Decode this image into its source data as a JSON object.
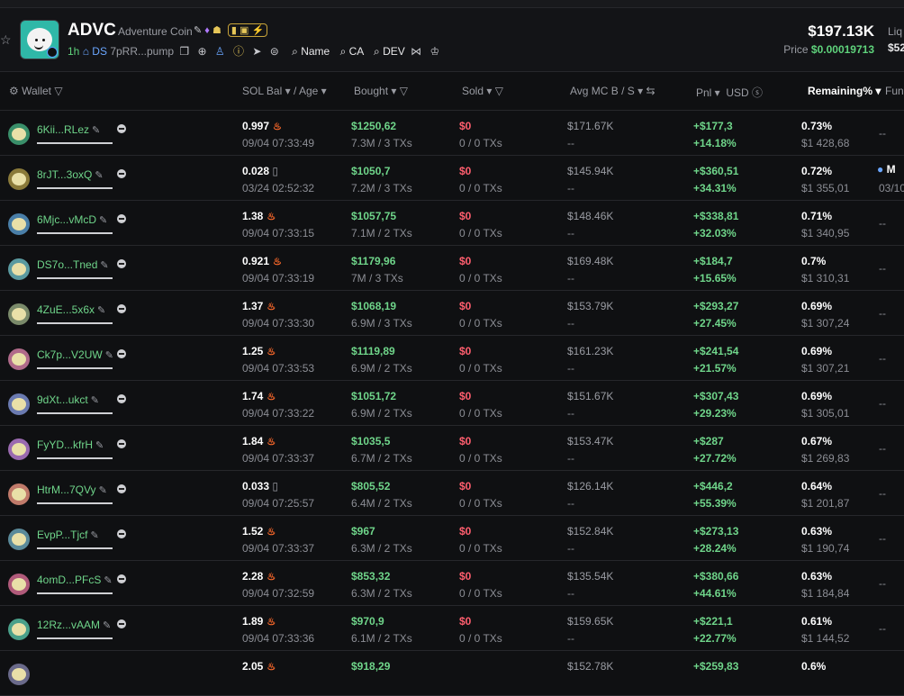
{
  "token": {
    "ticker": "ADVC",
    "name": "Adventure Coin",
    "age": "1h",
    "ds": "DS",
    "address": "7pRR...pump",
    "links": [
      "Name",
      "CA",
      "DEV"
    ],
    "market_cap": "$197.13K",
    "price_label": "Price",
    "price": "$0.00019713",
    "liq_label": "Liq",
    "liq_value": "$52"
  },
  "columns": {
    "wallet": "Wallet",
    "sol_bal": "SOL Bal",
    "age": "/ Age",
    "bought": "Bought",
    "sold": "Sold",
    "avg_mc": "Avg MC B",
    "avg_mc_s": "/ S",
    "pnl": "Pnl",
    "usd": "USD",
    "remaining": "Remaining%",
    "funding": "Fun"
  },
  "rows": [
    {
      "wallet": "6Kii...RLez",
      "sol": "0.997",
      "time": "09/04 07:33:49",
      "bought": "$1250,62",
      "bought_sub": "7.3M / 3 TXs",
      "sold": "$0",
      "sold_sub": "0 / 0 TXs",
      "avg": "$171.67K",
      "avg_sub": "--",
      "pnl": "+$177,3",
      "pnl_pct": "+14.18%",
      "rem": "0.73%",
      "rem_usd": "$1 428,68",
      "fund": "--",
      "fund_date": "",
      "color": "#3a8f6a"
    },
    {
      "wallet": "8rJT...3oxQ",
      "sol": "0.028",
      "time": "03/24 02:52:32",
      "bought": "$1050,7",
      "bought_sub": "7.2M / 3 TXs",
      "sold": "$0",
      "sold_sub": "0 / 0 TXs",
      "avg": "$145.94K",
      "avg_sub": "--",
      "pnl": "+$360,51",
      "pnl_pct": "+34.31%",
      "rem": "0.72%",
      "rem_usd": "$1 355,01",
      "fund": "M",
      "fund_date": "03/10",
      "color": "#8a7a3a"
    },
    {
      "wallet": "6Mjc...vMcD",
      "sol": "1.38",
      "time": "09/04 07:33:15",
      "bought": "$1057,75",
      "bought_sub": "7.1M / 2 TXs",
      "sold": "$0",
      "sold_sub": "0 / 0 TXs",
      "avg": "$148.46K",
      "avg_sub": "--",
      "pnl": "+$338,81",
      "pnl_pct": "+32.03%",
      "rem": "0.71%",
      "rem_usd": "$1 340,95",
      "fund": "--",
      "fund_date": "",
      "color": "#4a7fa8"
    },
    {
      "wallet": "DS7o...Tned",
      "sol": "0.921",
      "time": "09/04 07:33:19",
      "bought": "$1179,96",
      "bought_sub": "7M / 3 TXs",
      "sold": "$0",
      "sold_sub": "0 / 0 TXs",
      "avg": "$169.48K",
      "avg_sub": "--",
      "pnl": "+$184,7",
      "pnl_pct": "+15.65%",
      "rem": "0.7%",
      "rem_usd": "$1 310,31",
      "fund": "--",
      "fund_date": "",
      "color": "#5a9aa0"
    },
    {
      "wallet": "4ZuE...5x6x",
      "sol": "1.37",
      "time": "09/04 07:33:30",
      "bought": "$1068,19",
      "bought_sub": "6.9M / 3 TXs",
      "sold": "$0",
      "sold_sub": "0 / 0 TXs",
      "avg": "$153.79K",
      "avg_sub": "--",
      "pnl": "+$293,27",
      "pnl_pct": "+27.45%",
      "rem": "0.69%",
      "rem_usd": "$1 307,24",
      "fund": "--",
      "fund_date": "",
      "color": "#7a8a6a"
    },
    {
      "wallet": "Ck7p...V2UW",
      "sol": "1.25",
      "time": "09/04 07:33:53",
      "bought": "$1119,89",
      "bought_sub": "6.9M / 2 TXs",
      "sold": "$0",
      "sold_sub": "0 / 0 TXs",
      "avg": "$161.23K",
      "avg_sub": "--",
      "pnl": "+$241,54",
      "pnl_pct": "+21.57%",
      "rem": "0.69%",
      "rem_usd": "$1 307,21",
      "fund": "--",
      "fund_date": "",
      "color": "#b06a8a"
    },
    {
      "wallet": "9dXt...ukct",
      "sol": "1.74",
      "time": "09/04 07:33:22",
      "bought": "$1051,72",
      "bought_sub": "6.9M / 2 TXs",
      "sold": "$0",
      "sold_sub": "0 / 0 TXs",
      "avg": "$151.67K",
      "avg_sub": "--",
      "pnl": "+$307,43",
      "pnl_pct": "+29.23%",
      "rem": "0.69%",
      "rem_usd": "$1 305,01",
      "fund": "--",
      "fund_date": "",
      "color": "#6a7ab0"
    },
    {
      "wallet": "FyYD...kfrH",
      "sol": "1.84",
      "time": "09/04 07:33:37",
      "bought": "$1035,5",
      "bought_sub": "6.7M / 2 TXs",
      "sold": "$0",
      "sold_sub": "0 / 0 TXs",
      "avg": "$153.47K",
      "avg_sub": "--",
      "pnl": "+$287",
      "pnl_pct": "+27.72%",
      "rem": "0.67%",
      "rem_usd": "$1 269,83",
      "fund": "--",
      "fund_date": "",
      "color": "#9a6ab0"
    },
    {
      "wallet": "HtrM...7QVy",
      "sol": "0.033",
      "time": "09/04 07:25:57",
      "bought": "$805,52",
      "bought_sub": "6.4M / 2 TXs",
      "sold": "$0",
      "sold_sub": "0 / 0 TXs",
      "avg": "$126.14K",
      "avg_sub": "--",
      "pnl": "+$446,2",
      "pnl_pct": "+55.39%",
      "rem": "0.64%",
      "rem_usd": "$1 201,87",
      "fund": "--",
      "fund_date": "",
      "color": "#c07a6a"
    },
    {
      "wallet": "EvpP...Tjcf",
      "sol": "1.52",
      "time": "09/04 07:33:37",
      "bought": "$967",
      "bought_sub": "6.3M / 2 TXs",
      "sold": "$0",
      "sold_sub": "0 / 0 TXs",
      "avg": "$152.84K",
      "avg_sub": "--",
      "pnl": "+$273,13",
      "pnl_pct": "+28.24%",
      "rem": "0.63%",
      "rem_usd": "$1 190,74",
      "fund": "--",
      "fund_date": "",
      "color": "#5a8a9a"
    },
    {
      "wallet": "4omD...PFcS",
      "sol": "2.28",
      "time": "09/04 07:32:59",
      "bought": "$853,32",
      "bought_sub": "6.3M / 2 TXs",
      "sold": "$0",
      "sold_sub": "0 / 0 TXs",
      "avg": "$135.54K",
      "avg_sub": "--",
      "pnl": "+$380,66",
      "pnl_pct": "+44.61%",
      "rem": "0.63%",
      "rem_usd": "$1 184,84",
      "fund": "--",
      "fund_date": "",
      "color": "#b05a7a"
    },
    {
      "wallet": "12Rz...vAAM",
      "sol": "1.89",
      "time": "09/04 07:33:36",
      "bought": "$970,9",
      "bought_sub": "6.1M / 2 TXs",
      "sold": "$0",
      "sold_sub": "0 / 0 TXs",
      "avg": "$159.65K",
      "avg_sub": "--",
      "pnl": "+$221,1",
      "pnl_pct": "+22.77%",
      "rem": "0.61%",
      "rem_usd": "$1 144,52",
      "fund": "--",
      "fund_date": "",
      "color": "#4aa08a"
    },
    {
      "wallet": "",
      "sol": "2.05",
      "time": "",
      "bought": "$918,29",
      "bought_sub": "",
      "sold": "",
      "sold_sub": "",
      "avg": "$152.78K",
      "avg_sub": "",
      "pnl": "+$259,83",
      "pnl_pct": "",
      "rem": "0.6%",
      "rem_usd": "",
      "fund": "",
      "fund_date": "",
      "color": "#6a6a8a"
    }
  ],
  "colors": {
    "green": "#6fd58a",
    "red": "#ff5e6e",
    "bg": "#0f1012"
  }
}
